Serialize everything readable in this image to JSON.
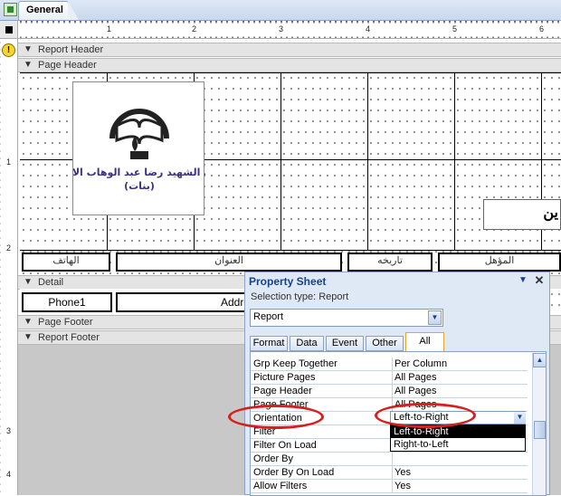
{
  "tab": {
    "label": "General"
  },
  "ruler": {
    "h_marks": [
      "1",
      "2",
      "3",
      "4",
      "5",
      "6"
    ],
    "v_marks": [
      "1",
      "2",
      "3",
      "4"
    ]
  },
  "sections": {
    "report_header": "Report Header",
    "page_header": "Page Header",
    "detail": "Detail",
    "page_footer": "Page Footer",
    "report_footer": "Report Footer"
  },
  "header_labels": {
    "phone": "الهاتف",
    "address": "العنوان",
    "date": "تاريخه",
    "qualification": "المؤهل",
    "cut_text": "ين"
  },
  "detail_fields": {
    "phone": "Phone1",
    "address": "Addres"
  },
  "logo": {
    "text_line1": "مدرسة الشهيد رضا عبد الوهاب الابتدائية",
    "text_line2": "(بنات)"
  },
  "property_sheet": {
    "title": "Property Sheet",
    "selection_label": "Selection type:  Report",
    "selected_object": "Report",
    "tabs": [
      "Format",
      "Data",
      "Event",
      "Other",
      "All"
    ],
    "rows": [
      {
        "name": "Grp Keep Together",
        "value": "Per Column"
      },
      {
        "name": "Picture Pages",
        "value": "All Pages"
      },
      {
        "name": "Page Header",
        "value": "All Pages"
      },
      {
        "name": "Page Footer",
        "value": "All Pages"
      },
      {
        "name": "Orientation",
        "value": "Left-to-Right"
      },
      {
        "name": "Filter",
        "value": ""
      },
      {
        "name": "Filter On Load",
        "value": ""
      },
      {
        "name": "Order By",
        "value": ""
      },
      {
        "name": "Order By On Load",
        "value": "Yes"
      },
      {
        "name": "Allow Filters",
        "value": "Yes"
      }
    ],
    "orientation_options": [
      "Left-to-Right",
      "Right-to-Left"
    ]
  },
  "colors": {
    "highlight_ellipse": "#d61f1f",
    "active_tab_border": "#e4a82d",
    "panel_bg": "#dfe8f5"
  }
}
